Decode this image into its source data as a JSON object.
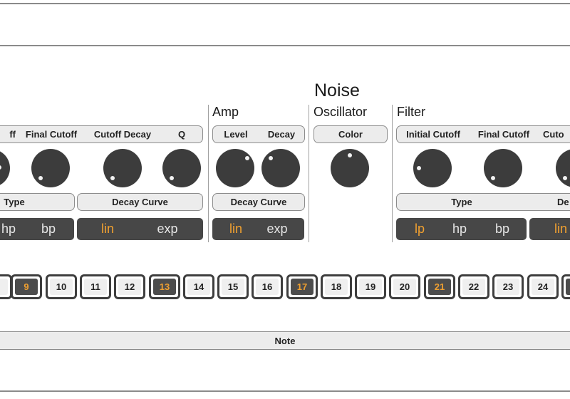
{
  "title": "Noise",
  "sections": {
    "amp": "Amp",
    "oscillator": "Oscillator",
    "filter": "Filter"
  },
  "left": {
    "labels": [
      "ff",
      "Final Cutoff",
      "Cutoff Decay",
      "Q"
    ],
    "type_label": "Type",
    "decay_curve_label": "Decay Curve",
    "filter_options": [
      "hp",
      "bp"
    ],
    "curve_options": [
      "lin",
      "exp"
    ]
  },
  "amp": {
    "labels": [
      "Level",
      "Decay"
    ],
    "decay_curve_label": "Decay Curve",
    "curve_options": [
      "lin",
      "exp"
    ]
  },
  "oscillator": {
    "labels": [
      "Color"
    ]
  },
  "filter": {
    "labels": [
      "Initial Cutoff",
      "Final Cutoff",
      "Cuto"
    ],
    "type_label": "Type",
    "decay_curve_label": "De",
    "filter_options": [
      "lp",
      "hp",
      "bp"
    ],
    "curve_options": [
      "lin"
    ]
  },
  "steps": [
    "9",
    "10",
    "11",
    "12",
    "13",
    "14",
    "15",
    "16",
    "17",
    "18",
    "19",
    "20",
    "21",
    "22",
    "23",
    "24"
  ],
  "accent_steps": [
    "9",
    "13",
    "17",
    "21"
  ],
  "note_label": "Note",
  "colors": {
    "accent": "#f0a030",
    "panel": "#474747",
    "knob": "#3c3c3c",
    "bar": "#ececec"
  }
}
